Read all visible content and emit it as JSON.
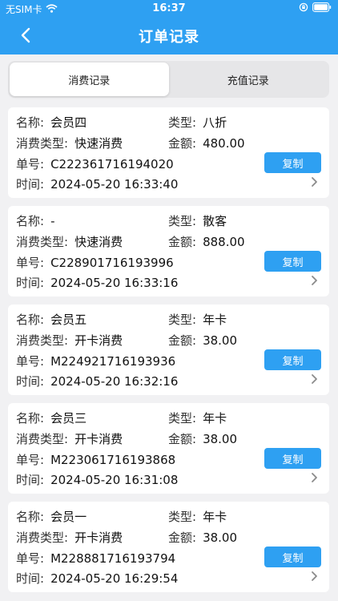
{
  "status_bar": {
    "carrier": "无SIM卡",
    "time": "16:37"
  },
  "header": {
    "title": "订单记录"
  },
  "tabs": [
    {
      "label": "消费记录",
      "active": true
    },
    {
      "label": "充值记录",
      "active": false
    }
  ],
  "labels": {
    "name": "名称:",
    "type": "类型:",
    "consume_type": "消费类型:",
    "amount": "金额:",
    "order_no": "单号:",
    "time": "时间:",
    "copy": "复制"
  },
  "orders": [
    {
      "name": "会员四",
      "type": "八折",
      "consume_type": "快速消费",
      "amount": "480.00",
      "order_no": "C222361716194020",
      "time": "2024-05-20 16:33:40"
    },
    {
      "name": "-",
      "type": "散客",
      "consume_type": "快速消费",
      "amount": "888.00",
      "order_no": "C228901716193996",
      "time": "2024-05-20 16:33:16"
    },
    {
      "name": "会员五",
      "type": "年卡",
      "consume_type": "开卡消费",
      "amount": "38.00",
      "order_no": "M224921716193936",
      "time": "2024-05-20 16:32:16"
    },
    {
      "name": "会员三",
      "type": "年卡",
      "consume_type": "开卡消费",
      "amount": "38.00",
      "order_no": "M223061716193868",
      "time": "2024-05-20 16:31:08"
    },
    {
      "name": "会员一",
      "type": "年卡",
      "consume_type": "开卡消费",
      "amount": "38.00",
      "order_no": "M228881716193794",
      "time": "2024-05-20 16:29:54"
    }
  ],
  "colors": {
    "accent": "#2ea0f2",
    "background": "#f1f1f3"
  }
}
